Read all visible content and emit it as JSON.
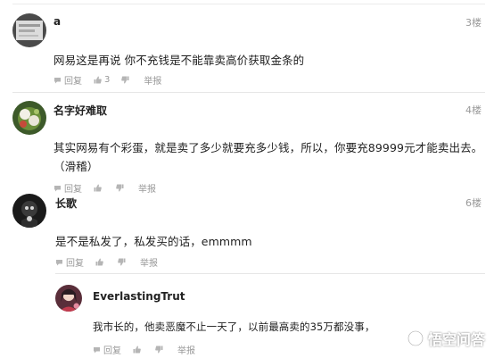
{
  "comments": [
    {
      "author": "a",
      "floor": "3楼",
      "content": "网易这是再说 你不充钱是不能靠卖高价获取金条的",
      "reply_label": "回复",
      "like_count": "3",
      "report_label": "举报"
    },
    {
      "author": "名字好难取",
      "floor": "4楼",
      "content_line1": "其实网易有个彩蛋，就是卖了多少就要充多少钱，所以，你要充89999元才能卖出去。",
      "content_line2": "（滑稽）",
      "reply_label": "回复",
      "report_label": "举报"
    },
    {
      "author": "长歌",
      "floor": "6楼",
      "content": "是不是私发了，私发买的话，emmmm",
      "reply_label": "回复",
      "report_label": "举报"
    }
  ],
  "reply": {
    "author": "EverlastingTrut",
    "content": "我市长的，他卖恶魔不止一天了，以前最高卖的35万都没事，",
    "reply_label": "回复",
    "report_label": "举报"
  },
  "watermark": {
    "text": "悟空问答",
    "icon": "wukong-logo-icon"
  },
  "icons": {
    "reply": "speech-bubble-icon",
    "like": "thumbs-up-icon",
    "dislike": "thumbs-down-icon"
  },
  "colors": {
    "meta_gray": "#999999",
    "text": "#222222"
  }
}
